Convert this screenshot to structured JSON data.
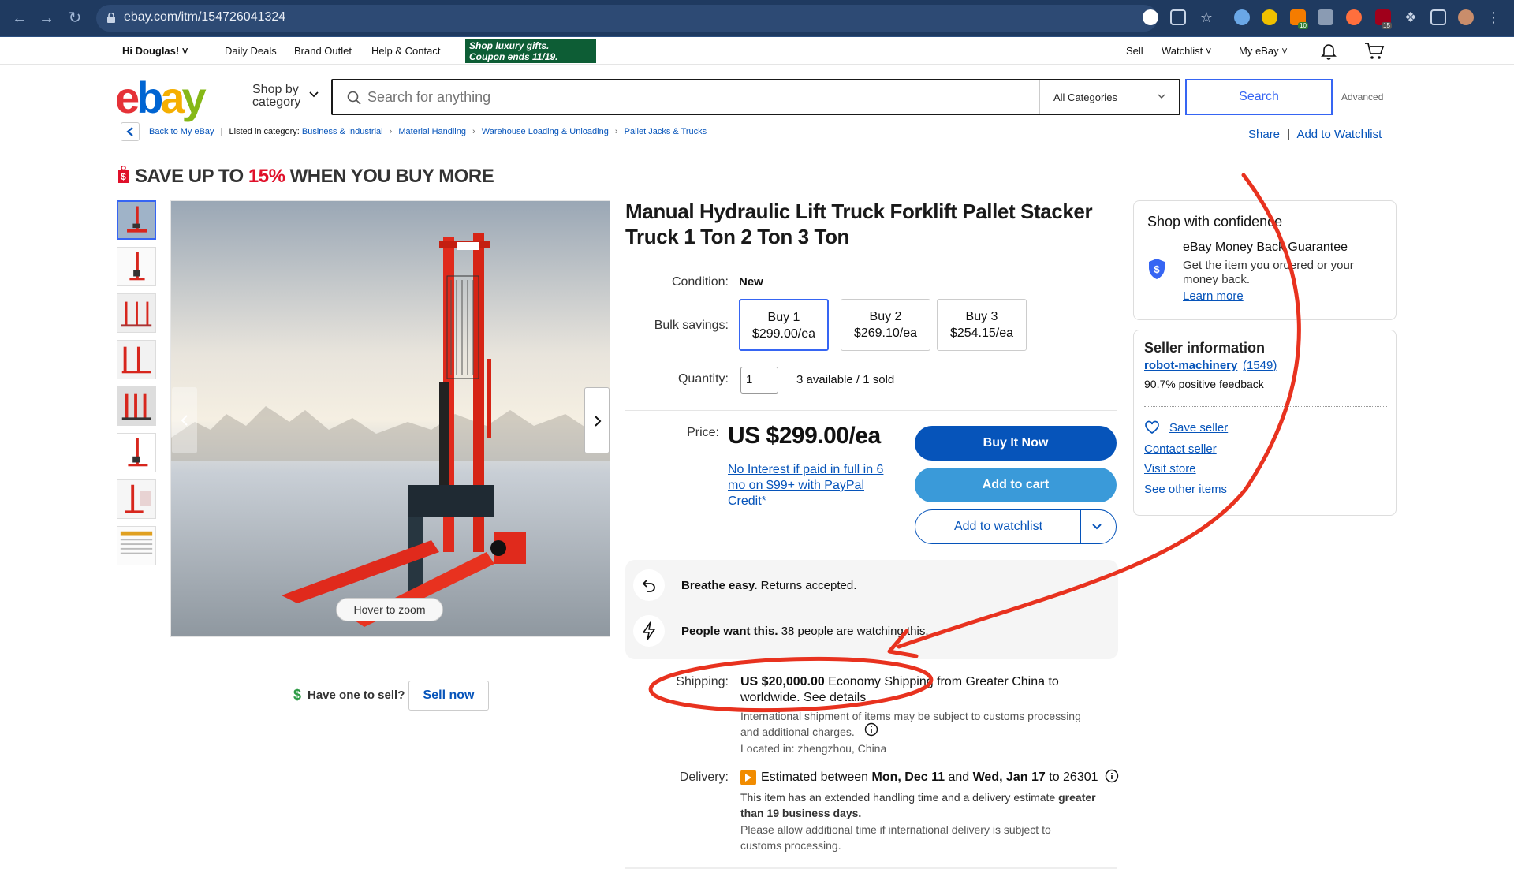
{
  "browser": {
    "url": "ebay.com/itm/154726041324",
    "ext_badge_1": "10",
    "ext_badge_2": "15"
  },
  "topbar": {
    "greeting": "Hi Douglas!",
    "daily_deals": "Daily Deals",
    "brand_outlet": "Brand Outlet",
    "help": "Help & Contact",
    "promo_line1": "Shop luxury gifts.",
    "promo_line2": "Coupon ends 11/19.",
    "sell": "Sell",
    "watchlist": "Watchlist",
    "my_ebay": "My eBay"
  },
  "header": {
    "logo": {
      "e": "e",
      "b": "b",
      "a": "a",
      "y": "y"
    },
    "shop_by_1": "Shop by",
    "shop_by_2": "category",
    "search_placeholder": "Search for anything",
    "category": "All Categories",
    "search_button": "Search",
    "advanced": "Advanced"
  },
  "breadcrumb": {
    "back": "Back to My eBay",
    "listed": "Listed in category:",
    "items": [
      "Business & Industrial",
      "Material Handling",
      "Warehouse Loading & Unloading",
      "Pallet Jacks & Trucks"
    ],
    "share": "Share",
    "add_watchlist": "Add to Watchlist"
  },
  "banner": {
    "pre": "SAVE UP TO ",
    "pct": "15%",
    "post": " WHEN YOU BUY MORE"
  },
  "gallery": {
    "hover_zoom": "Hover to zoom",
    "have_one": "Have one to sell?",
    "sell_now": "Sell now"
  },
  "item": {
    "title": "Manual Hydraulic Lift Truck Forklift Pallet Stacker Truck 1 Ton 2 Ton 3 Ton",
    "condition_label": "Condition:",
    "condition": "New",
    "bulk_label": "Bulk savings:",
    "bulk": [
      {
        "name": "Buy 1",
        "price": "$299.00/ea"
      },
      {
        "name": "Buy 2",
        "price": "$269.10/ea"
      },
      {
        "name": "Buy 3",
        "price": "$254.15/ea"
      }
    ],
    "quantity_label": "Quantity:",
    "quantity": "1",
    "availability": "3 available / 1 sold",
    "price_label": "Price:",
    "price": "US $299.00/ea",
    "paypal": "No Interest if paid in full in 6 mo on $99+ with PayPal Credit*",
    "buy_now": "Buy It Now",
    "add_cart": "Add to cart",
    "add_watchlist": "Add to watchlist"
  },
  "highlights": {
    "returns_bold": "Breathe easy.",
    "returns": " Returns accepted.",
    "watch_bold": "People want this.",
    "watch": " 38 people are watching this."
  },
  "shipping": {
    "label": "Shipping:",
    "cost": "US $20,000.00",
    "line1_rest": " Economy Shipping from Greater China to",
    "line2": "worldwide. See details",
    "customs1": "International shipment of items may be subject to customs processing",
    "customs2": "and additional charges.",
    "located": "Located in: zhengzhou, China"
  },
  "delivery": {
    "label": "Delivery:",
    "est_pre": "Estimated between ",
    "date1": "Mon, Dec 11",
    "and": " and ",
    "date2": "Wed, Jan 17",
    "to": " to 26301",
    "note1_pre": "This item has an extended handling time and a delivery estimate ",
    "note1_bold": "greater",
    "note2_bold": "than 19 business days.",
    "note3": "Please allow additional time if international delivery is subject to",
    "note4": "customs processing."
  },
  "confidence": {
    "title": "Shop with confidence",
    "guarantee": "eBay Money Back Guarantee",
    "desc1": "Get the item you ordered or your",
    "desc2": "money back.",
    "learn": "Learn more"
  },
  "seller": {
    "title": "Seller information",
    "name": "robot-machinery",
    "score": "(1549)",
    "feedback": "90.7% positive feedback",
    "save": "Save seller",
    "contact": "Contact seller",
    "visit": "Visit store",
    "other": "See other items"
  },
  "colors": {
    "ebay_blue": "#0654ba",
    "annotation_red": "#e8321f",
    "promo_green": "#0d5d35"
  }
}
